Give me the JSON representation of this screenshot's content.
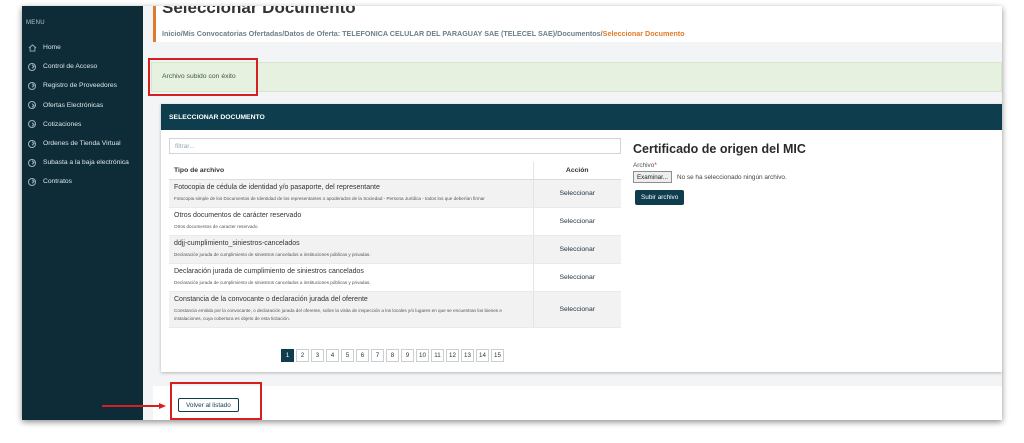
{
  "sidebar": {
    "menu_label": "MENU",
    "items": [
      {
        "label": "Home",
        "icon": "home-icon"
      },
      {
        "label": "Control de Acceso",
        "icon": "chevron-right-icon"
      },
      {
        "label": "Registro de Proveedores",
        "icon": "chevron-right-icon"
      },
      {
        "label": "Ofertas Electrónicas",
        "icon": "chevron-right-icon"
      },
      {
        "label": "Cotizaciones",
        "icon": "chevron-right-icon"
      },
      {
        "label": "Ordenes de Tienda Virtual",
        "icon": "chevron-right-icon"
      },
      {
        "label": "Subasta a la baja electrónica",
        "icon": "chevron-right-icon"
      },
      {
        "label": "Contratos",
        "icon": "chevron-right-icon"
      }
    ]
  },
  "header": {
    "title": "Seleccionar Documento",
    "breadcrumb": [
      "Inicio",
      "Mis Convocatorias Ofertadas",
      "Datos de Oferta: TELEFONICA CELULAR DEL PARAGUAY SAE (TELECEL SAE)",
      "Documentos",
      "Seleccionar Documento"
    ]
  },
  "alert": {
    "text": "Archivo subido con éxito"
  },
  "card": {
    "heading": "SELECCIONAR DOCUMENTO",
    "filter_placeholder": "filtrar...",
    "columns": {
      "type": "Tipo de archivo",
      "action": "Acción"
    },
    "rows": [
      {
        "title": "Fotocopia de cédula de identidad y/o pasaporte, del representante",
        "desc": "Fotocopia simple de los Documentos de Identidad de los representantes o apoderados de la Sociedad - Persona Jurídica - todos los que deberían firmar",
        "action": "Seleccionar"
      },
      {
        "title": "Otros documentos de carácter reservado",
        "desc": "Otros documentos de caracter reservado",
        "action": "Seleccionar"
      },
      {
        "title": "ddjj-cumplimiento_siniestros-cancelados",
        "desc": "Declaración jurada de cumplimiento de siniestros cancelados a instituciones públicas y privadas.",
        "action": "Seleccionar"
      },
      {
        "title": "Declaración jurada de cumplimiento de siniestros cancelados",
        "desc": "Declaración jurada de cumplimiento de siniestros cancelados a instituciones públicas y privadas.",
        "action": "Seleccionar"
      },
      {
        "title": "Constancia de la convocante o declaración jurada del oferente",
        "desc": "Constancia emitida por la convocante, o declaración jurada del oferente, sobre la visita de inspección a los locales y/o lugares en que se encuentran los bienes e instalaciones, cuya cobertura es objeto de esta licitación.",
        "action": "Seleccionar"
      }
    ],
    "pages": [
      "1",
      "2",
      "3",
      "4",
      "5",
      "6",
      "7",
      "8",
      "9",
      "10",
      "11",
      "12",
      "13",
      "14",
      "15"
    ],
    "active_page": "1"
  },
  "upload": {
    "title": "Certificado de origen del MIC",
    "field_label": "Archivo",
    "required_mark": "*",
    "browse_label": "Examinar...",
    "no_file_text": "No se ha seleccionado ningún archivo.",
    "submit_label": "Subir archivo"
  },
  "footer": {
    "back_label": "Volver al listado"
  },
  "colors": {
    "sidebar": "#0e2c38",
    "accent": "#e07b2a",
    "primary": "#0e3d4e",
    "success_bg": "#e6f1df",
    "annotation": "#d42020"
  }
}
